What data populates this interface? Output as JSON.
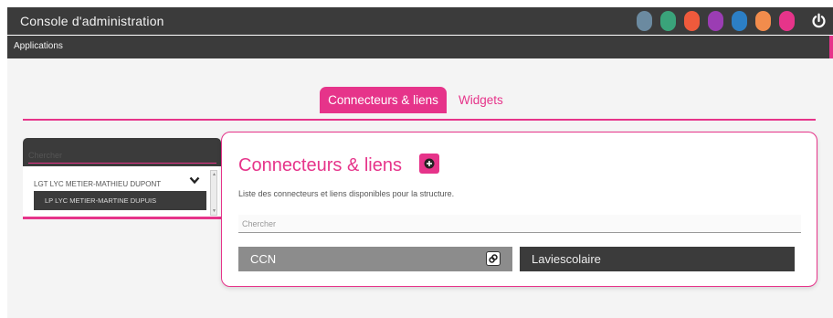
{
  "header": {
    "title": "Console d'administration",
    "dots": [
      {
        "name": "blue-grey",
        "color": "#6b8aa0"
      },
      {
        "name": "green",
        "color": "#3aa37a"
      },
      {
        "name": "orange-red",
        "color": "#ef5a3c"
      },
      {
        "name": "purple",
        "color": "#9b3db3"
      },
      {
        "name": "blue",
        "color": "#2c7fc5"
      },
      {
        "name": "orange",
        "color": "#f28c4c"
      },
      {
        "name": "pink",
        "color": "#e6348a"
      }
    ],
    "power_icon": "power-icon"
  },
  "appbar": {
    "label": "Applications"
  },
  "tabs": [
    {
      "label": "Connecteurs & liens",
      "active": true
    },
    {
      "label": "Widgets",
      "active": false
    }
  ],
  "sidebar": {
    "search_placeholder": "Chercher",
    "items": [
      {
        "label": "LGT LYC METIER-MATHIEU DUPONT",
        "expanded": true
      },
      {
        "label": "LP LYC METIER-MARTINE DUPUIS",
        "selected": true
      }
    ]
  },
  "main": {
    "title": "Connecteurs & liens",
    "description": "Liste des connecteurs et liens disponibles pour la structure.",
    "search_placeholder": "Chercher",
    "connectors": [
      {
        "label": "CCN",
        "icon": "link-icon"
      },
      {
        "label": "Laviescolaire"
      }
    ]
  },
  "colors": {
    "accent": "#e6348a",
    "dark": "#3b3b3b",
    "background": "#f4f4f4"
  }
}
